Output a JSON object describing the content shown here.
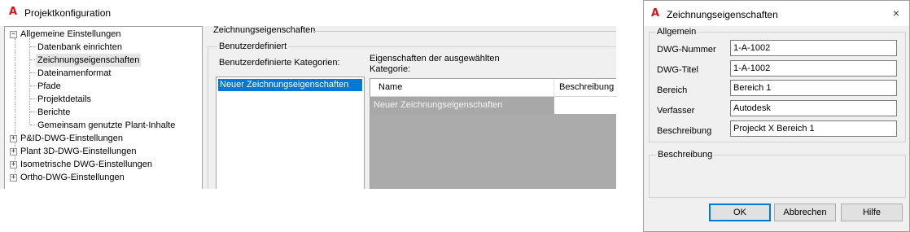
{
  "config_window": {
    "title": "Projektkonfiguration",
    "tree": [
      {
        "label": "Allgemeine Einstellungen",
        "expander": "−",
        "level": 0
      },
      {
        "label": "Datenbank einrichten",
        "level": 1
      },
      {
        "label": "Zeichnungseigenschaften",
        "level": 1,
        "selected": true
      },
      {
        "label": "Dateinamenformat",
        "level": 1
      },
      {
        "label": "Pfade",
        "level": 1
      },
      {
        "label": "Projektdetails",
        "level": 1
      },
      {
        "label": "Berichte",
        "level": 1
      },
      {
        "label": "Gemeinsam genutzte Plant-Inhalte",
        "level": 1
      },
      {
        "label": "P&ID-DWG-Einstellungen",
        "expander": "+",
        "level": 0
      },
      {
        "label": "Plant 3D-DWG-Einstellungen",
        "expander": "+",
        "level": 0
      },
      {
        "label": "Isometrische DWG-Einstellungen",
        "expander": "+",
        "level": 0
      },
      {
        "label": "Ortho-DWG-Einstellungen",
        "expander": "+",
        "level": 0
      }
    ],
    "section_title": "Zeichnungseigenschaften",
    "group_label": "Benutzerdefiniert",
    "categories_label": "Benutzerdefinierte Kategorien:",
    "properties_label_line1": "Eigenschaften der ausgewählten",
    "properties_label_line2": "Kategorie:",
    "categories": [
      "Neuer Zeichnungseigenschaften"
    ],
    "grid": {
      "columns": [
        "Name",
        "Beschreibung"
      ],
      "rows": [
        {
          "name": "Neuer Zeichnungseigenschaften",
          "description": ""
        }
      ]
    }
  },
  "dialog": {
    "title": "Zeichnungseigenschaften",
    "close_icon": "×",
    "group_label": "Allgemein",
    "fields": [
      {
        "label": "DWG-Nummer",
        "value": "1-A-1002"
      },
      {
        "label": "DWG-Titel",
        "value": "1-A-1002"
      },
      {
        "label": "Bereich",
        "value": "Bereich 1"
      },
      {
        "label": "Verfasser",
        "value": "Autodesk"
      },
      {
        "label": "Beschreibung",
        "value": "Projeckt X Bereich 1"
      }
    ],
    "description_group_label": "Beschreibung",
    "buttons": {
      "ok": "OK",
      "cancel": "Abbrechen",
      "help": "Hilfe"
    }
  },
  "colors": {
    "accent": "#0078d7",
    "logo": "#d8141a",
    "dialog_bg": "#f0f0f0"
  }
}
